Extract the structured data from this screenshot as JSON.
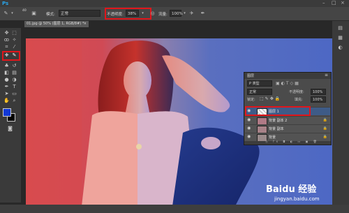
{
  "app": {
    "logo": "Ps"
  },
  "options": {
    "mode_label": "模式:",
    "mode_value": "正常",
    "opacity_label": "不透明度:",
    "opacity_value": "38%",
    "flow_label": "流量:",
    "flow_value": "100%",
    "brush_size": "40"
  },
  "document": {
    "tab_title": "01.jpg @ 50% (图层 1, RGB/8#) *",
    "close": "×"
  },
  "layers_panel": {
    "title": "图层",
    "kind_label": "P 类型",
    "blend_mode": "正常",
    "opacity_label": "不透明度:",
    "opacity_value": "100%",
    "lock_label": "锁定:",
    "fill_label": "填充:",
    "fill_value": "100%",
    "layers": [
      {
        "name": "图层 1",
        "selected": true
      },
      {
        "name": "背景 副本 2",
        "selected": false
      },
      {
        "name": "背景 副本",
        "selected": false
      },
      {
        "name": "背景",
        "selected": false
      }
    ],
    "footer_icons": "ⓖ fx ◘ ◐ ▭ ▣ 🗑"
  },
  "watermark": {
    "brand": "Baidu 经验",
    "url": "jingyan.baidu.com"
  },
  "colors": {
    "accent": "#2aa4e8",
    "highlight": "#e0161b",
    "foreground": "#1138d6",
    "background": "#000000"
  }
}
